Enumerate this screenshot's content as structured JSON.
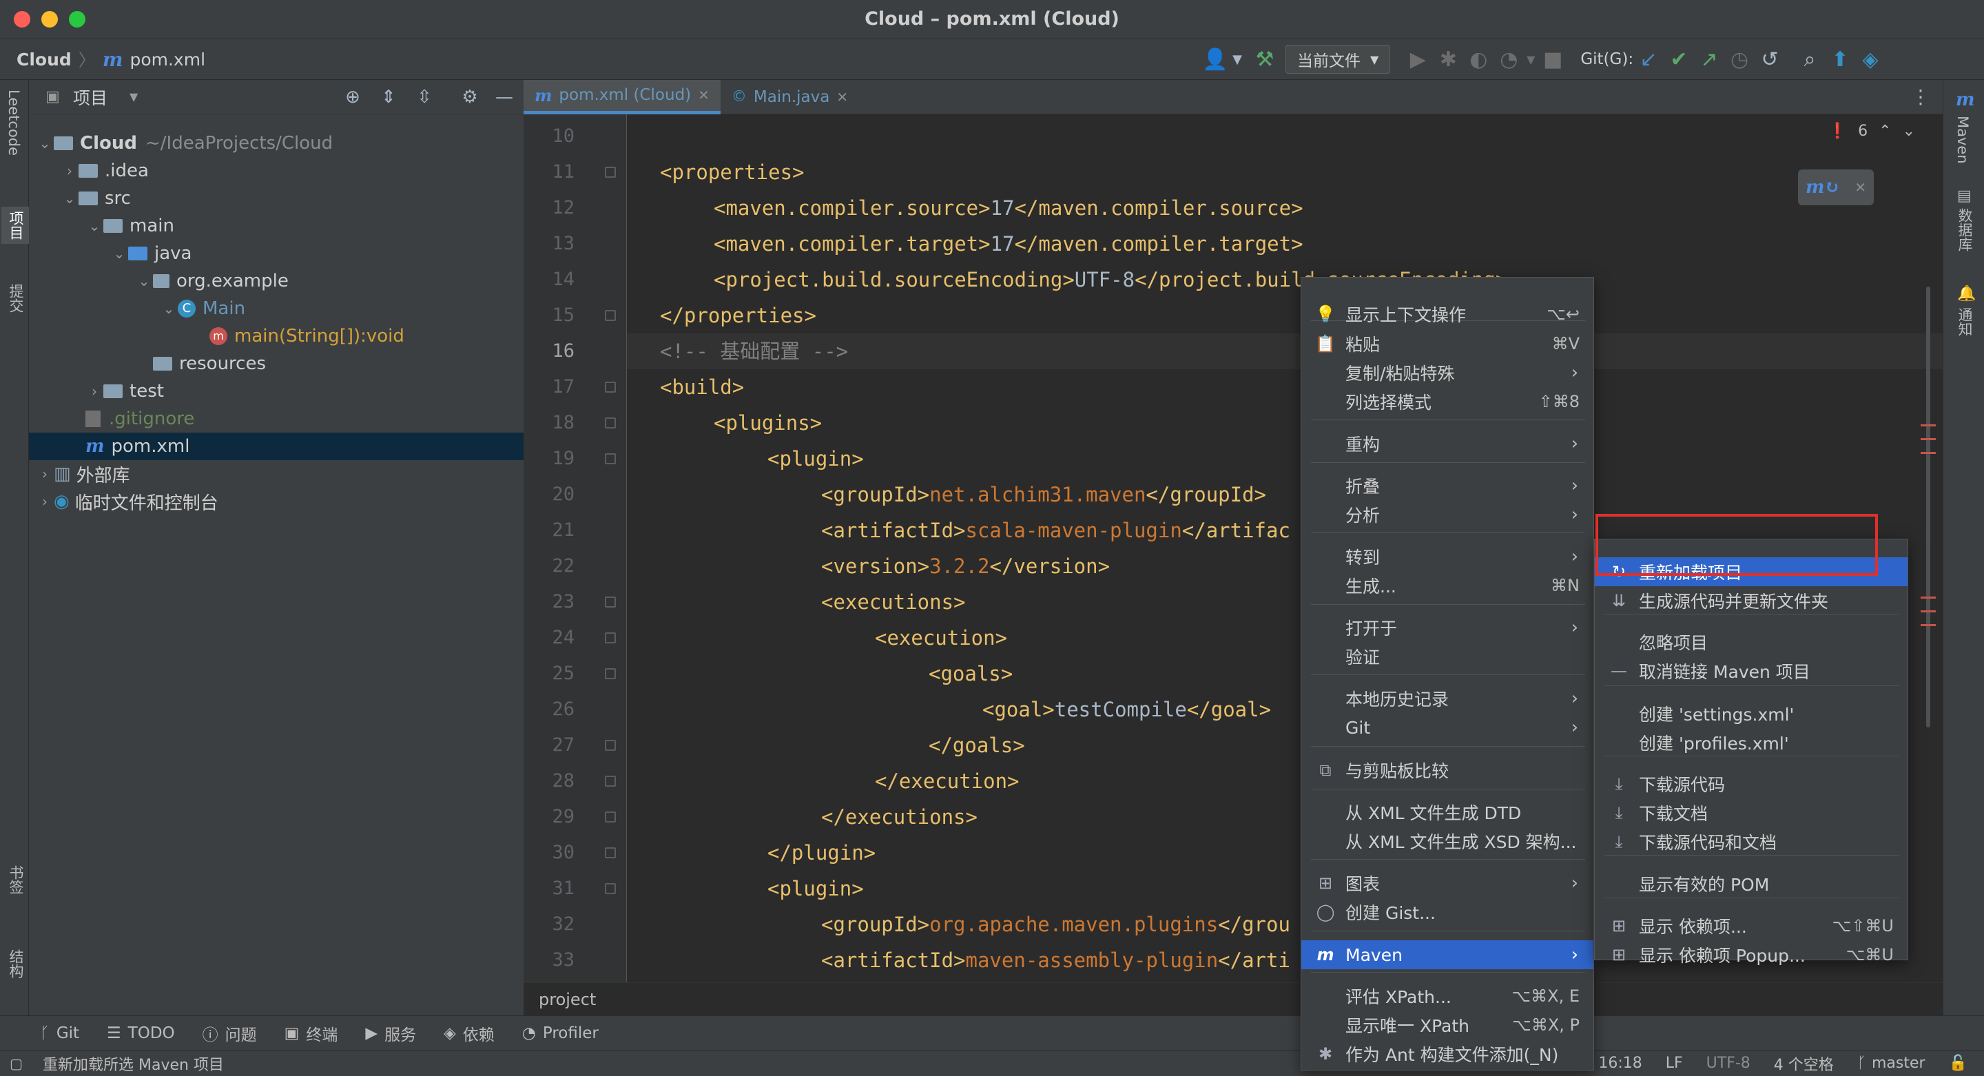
{
  "window": {
    "title": "Cloud – pom.xml (Cloud)"
  },
  "nav": {
    "project": "Cloud",
    "file": "pom.xml",
    "run_config": "当前文件",
    "git_label": "Git(G):"
  },
  "left_strip": {
    "leetcode": "Leetcode",
    "project": "项目",
    "commit": "提交",
    "bookmarks": "书签",
    "structure": "结构"
  },
  "right_strip": {
    "maven": "Maven",
    "database": "数据库",
    "notifications": "通知"
  },
  "project_panel": {
    "title": "项目",
    "tree": [
      {
        "label": "Cloud",
        "suffix": "~/IdeaProjects/Cloud"
      },
      {
        "label": ".idea"
      },
      {
        "label": "src"
      },
      {
        "label": "main"
      },
      {
        "label": "java"
      },
      {
        "label": "org.example"
      },
      {
        "label": "Main"
      },
      {
        "label": "main(String[]):void"
      },
      {
        "label": "resources"
      },
      {
        "label": "test"
      },
      {
        "label": ".gitignore"
      },
      {
        "label": "pom.xml"
      },
      {
        "label": "外部库"
      },
      {
        "label": "临时文件和控制台"
      }
    ]
  },
  "tabs": [
    {
      "label": "pom.xml (Cloud)"
    },
    {
      "label": "Main.java"
    }
  ],
  "editor": {
    "error_count": "6",
    "lines": [
      {
        "n": "10",
        "a": "",
        "b": "",
        "c": ""
      },
      {
        "n": "11",
        "a": "<properties>",
        "b": "",
        "c": ""
      },
      {
        "n": "12",
        "a": "<maven.compiler.source>",
        "b": "17",
        "c": "</maven.compiler.source>"
      },
      {
        "n": "13",
        "a": "<maven.compiler.target>",
        "b": "17",
        "c": "</maven.compiler.target>"
      },
      {
        "n": "14",
        "a": "<project.build.sourceEncoding>",
        "b": "UTF-8",
        "c": "</project.build.sourceEncoding>"
      },
      {
        "n": "15",
        "a": "</properties>",
        "b": "",
        "c": ""
      },
      {
        "n": "16",
        "a": "<!-- 基础配置 -->",
        "b": "",
        "c": ""
      },
      {
        "n": "17",
        "a": "<build>",
        "b": "",
        "c": ""
      },
      {
        "n": "18",
        "a": "<plugins>",
        "b": "",
        "c": ""
      },
      {
        "n": "19",
        "a": "<plugin>",
        "b": "",
        "c": ""
      },
      {
        "n": "20",
        "a": "<groupId>",
        "b": "net.alchim31.maven",
        "c": "</groupId>"
      },
      {
        "n": "21",
        "a": "<artifactId>",
        "b": "scala-maven-plugin",
        "c": "</artifac"
      },
      {
        "n": "22",
        "a": "<version>",
        "b": "3.2.2",
        "c": "</version>"
      },
      {
        "n": "23",
        "a": "<executions>",
        "b": "",
        "c": ""
      },
      {
        "n": "24",
        "a": "<execution>",
        "b": "",
        "c": ""
      },
      {
        "n": "25",
        "a": "<goals>",
        "b": "",
        "c": ""
      },
      {
        "n": "26",
        "a": "<goal>",
        "b": "testCompile",
        "c": "</goal>"
      },
      {
        "n": "27",
        "a": "</goals>",
        "b": "",
        "c": ""
      },
      {
        "n": "28",
        "a": "</execution>",
        "b": "",
        "c": ""
      },
      {
        "n": "29",
        "a": "</executions>",
        "b": "",
        "c": ""
      },
      {
        "n": "30",
        "a": "</plugin>",
        "b": "",
        "c": ""
      },
      {
        "n": "31",
        "a": "<plugin>",
        "b": "",
        "c": ""
      },
      {
        "n": "32",
        "a": "<groupId>",
        "b": "org.apache.maven.plugins",
        "c": "</grou"
      },
      {
        "n": "33",
        "a": "<artifactId>",
        "b": "maven-assembly-plugin",
        "c": "</arti"
      }
    ],
    "breadcrumb": "project"
  },
  "context_menu": [
    {
      "label": "显示上下文操作",
      "shortcut": "⌥↩"
    },
    {
      "label": "粘贴",
      "shortcut": "⌘V"
    },
    {
      "label": "复制/粘贴特殊",
      "shortcut": ""
    },
    {
      "label": "列选择模式",
      "shortcut": "⇧⌘8"
    },
    {
      "label": "重构",
      "shortcut": ""
    },
    {
      "label": "折叠",
      "shortcut": ""
    },
    {
      "label": "分析",
      "shortcut": ""
    },
    {
      "label": "转到",
      "shortcut": ""
    },
    {
      "label": "生成...",
      "shortcut": "⌘N"
    },
    {
      "label": "打开于",
      "shortcut": ""
    },
    {
      "label": "验证",
      "shortcut": ""
    },
    {
      "label": "本地历史记录",
      "shortcut": ""
    },
    {
      "label": "Git",
      "shortcut": ""
    },
    {
      "label": "与剪贴板比较",
      "shortcut": ""
    },
    {
      "label": "从 XML 文件生成 DTD",
      "shortcut": ""
    },
    {
      "label": "从 XML 文件生成 XSD 架构...",
      "shortcut": ""
    },
    {
      "label": "图表",
      "shortcut": ""
    },
    {
      "label": "创建 Gist...",
      "shortcut": ""
    },
    {
      "label": "Maven",
      "shortcut": ""
    },
    {
      "label": "评估 XPath...",
      "shortcut": "⌥⌘X, E"
    },
    {
      "label": "显示唯一 XPath",
      "shortcut": "⌥⌘X, P"
    },
    {
      "label": "作为 Ant 构建文件添加(_N)",
      "shortcut": ""
    }
  ],
  "maven_menu": [
    {
      "label": "重新加载项目",
      "shortcut": ""
    },
    {
      "label": "生成源代码并更新文件夹",
      "shortcut": ""
    },
    {
      "label": "忽略项目",
      "shortcut": ""
    },
    {
      "label": "取消链接 Maven 项目",
      "shortcut": ""
    },
    {
      "label": "创建 'settings.xml'",
      "shortcut": ""
    },
    {
      "label": "创建 'profiles.xml'",
      "shortcut": ""
    },
    {
      "label": "下载源代码",
      "shortcut": ""
    },
    {
      "label": "下载文档",
      "shortcut": ""
    },
    {
      "label": "下载源代码和文档",
      "shortcut": ""
    },
    {
      "label": "显示有效的 POM",
      "shortcut": ""
    },
    {
      "label": "显示 依赖项...",
      "shortcut": "⌥⇧⌘U"
    },
    {
      "label": "显示 依赖项 Popup...",
      "shortcut": "⌥⌘U"
    }
  ],
  "bottom_tools": [
    "Git",
    "TODO",
    "问题",
    "终端",
    "服务",
    "依赖",
    "Profiler"
  ],
  "status": {
    "message": "重新加载所选 Maven 项目",
    "position": "16:18",
    "line_sep": "LF",
    "encoding": "UTF-8",
    "indent": "4 个空格",
    "branch": "master"
  },
  "colors": {
    "highlight": "#2f65ca",
    "annotation_box": "#e0302b",
    "tag": "#e8bf6a",
    "value": "#cc7832"
  }
}
